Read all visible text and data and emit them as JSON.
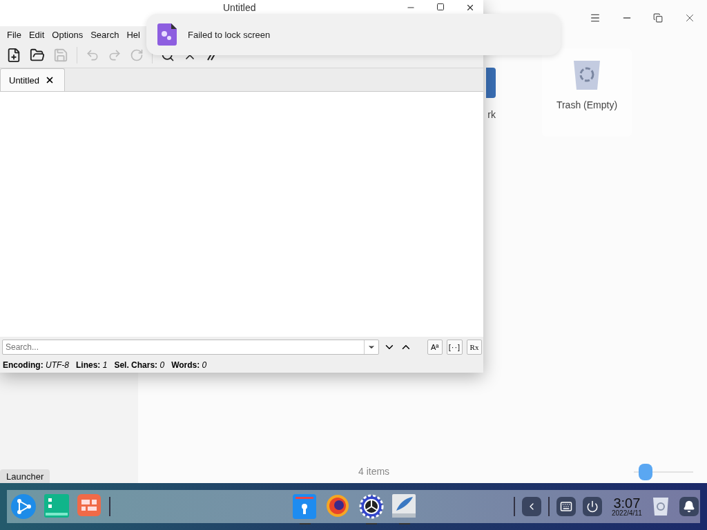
{
  "file_manager": {
    "items": [
      {
        "label": "rk",
        "kind": "folder"
      },
      {
        "label": "Trash (Empty)",
        "kind": "trash"
      }
    ],
    "status": "4 items",
    "zoom": {
      "level": 0.2
    }
  },
  "editor": {
    "title": "Untitled",
    "menu": [
      "File",
      "Edit",
      "Options",
      "Search",
      "Hel"
    ],
    "toolbar": [
      {
        "kind": "new",
        "disabled": false
      },
      {
        "kind": "open",
        "disabled": false
      },
      {
        "kind": "save",
        "disabled": true
      },
      {
        "kind": "sep",
        "disabled": false
      },
      {
        "kind": "undo",
        "disabled": true
      },
      {
        "kind": "redo",
        "disabled": true
      },
      {
        "kind": "reload",
        "disabled": true
      },
      {
        "kind": "sep",
        "disabled": false
      },
      {
        "kind": "find",
        "disabled": false
      },
      {
        "kind": "clear",
        "disabled": false
      },
      {
        "kind": "comment",
        "disabled": false
      }
    ],
    "tabs": [
      {
        "label": "Untitled",
        "selected": true
      }
    ],
    "search": {
      "placeholder": "Search..."
    },
    "search_buttons": [
      {
        "label": "Aª",
        "kind": "case"
      },
      {
        "label": "[··]",
        "kind": "word"
      },
      {
        "label": "Rx",
        "kind": "regex"
      }
    ],
    "status": [
      {
        "label": "Encoding:",
        "value": "UTF-8"
      },
      {
        "label": "Lines:",
        "value": "1"
      },
      {
        "label": "Sel. Chars:",
        "value": "0"
      },
      {
        "label": "Words:",
        "value": "0"
      }
    ]
  },
  "notification": {
    "text": "Failed to lock screen"
  },
  "dock": {
    "tooltip": "Launcher",
    "left_apps": [
      {
        "kind": "launcher",
        "running": false
      },
      {
        "kind": "terminal",
        "running": false
      },
      {
        "kind": "multitask",
        "running": false
      }
    ],
    "center_apps": [
      {
        "kind": "files",
        "running": true
      },
      {
        "kind": "firefox",
        "running": false
      },
      {
        "kind": "settings",
        "running": true
      },
      {
        "kind": "editor",
        "running": true
      }
    ],
    "time": "3:07",
    "date": "2022/4/11"
  }
}
